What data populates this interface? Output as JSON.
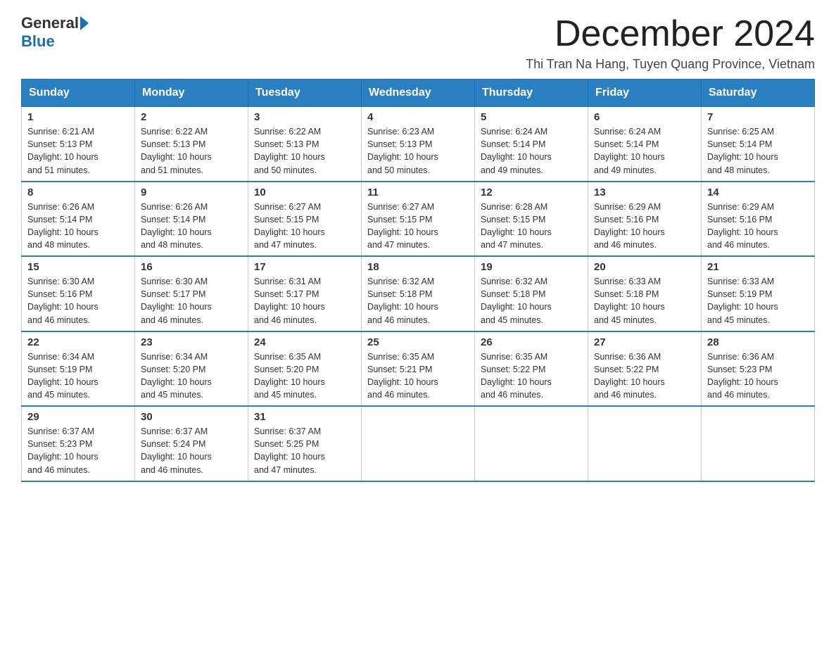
{
  "header": {
    "logo_general": "General",
    "logo_blue": "Blue",
    "month_title": "December 2024",
    "location": "Thi Tran Na Hang, Tuyen Quang Province, Vietnam"
  },
  "weekdays": [
    "Sunday",
    "Monday",
    "Tuesday",
    "Wednesday",
    "Thursday",
    "Friday",
    "Saturday"
  ],
  "weeks": [
    [
      {
        "day": "1",
        "sunrise": "6:21 AM",
        "sunset": "5:13 PM",
        "daylight": "10 hours and 51 minutes."
      },
      {
        "day": "2",
        "sunrise": "6:22 AM",
        "sunset": "5:13 PM",
        "daylight": "10 hours and 51 minutes."
      },
      {
        "day": "3",
        "sunrise": "6:22 AM",
        "sunset": "5:13 PM",
        "daylight": "10 hours and 50 minutes."
      },
      {
        "day": "4",
        "sunrise": "6:23 AM",
        "sunset": "5:13 PM",
        "daylight": "10 hours and 50 minutes."
      },
      {
        "day": "5",
        "sunrise": "6:24 AM",
        "sunset": "5:14 PM",
        "daylight": "10 hours and 49 minutes."
      },
      {
        "day": "6",
        "sunrise": "6:24 AM",
        "sunset": "5:14 PM",
        "daylight": "10 hours and 49 minutes."
      },
      {
        "day": "7",
        "sunrise": "6:25 AM",
        "sunset": "5:14 PM",
        "daylight": "10 hours and 48 minutes."
      }
    ],
    [
      {
        "day": "8",
        "sunrise": "6:26 AM",
        "sunset": "5:14 PM",
        "daylight": "10 hours and 48 minutes."
      },
      {
        "day": "9",
        "sunrise": "6:26 AM",
        "sunset": "5:14 PM",
        "daylight": "10 hours and 48 minutes."
      },
      {
        "day": "10",
        "sunrise": "6:27 AM",
        "sunset": "5:15 PM",
        "daylight": "10 hours and 47 minutes."
      },
      {
        "day": "11",
        "sunrise": "6:27 AM",
        "sunset": "5:15 PM",
        "daylight": "10 hours and 47 minutes."
      },
      {
        "day": "12",
        "sunrise": "6:28 AM",
        "sunset": "5:15 PM",
        "daylight": "10 hours and 47 minutes."
      },
      {
        "day": "13",
        "sunrise": "6:29 AM",
        "sunset": "5:16 PM",
        "daylight": "10 hours and 46 minutes."
      },
      {
        "day": "14",
        "sunrise": "6:29 AM",
        "sunset": "5:16 PM",
        "daylight": "10 hours and 46 minutes."
      }
    ],
    [
      {
        "day": "15",
        "sunrise": "6:30 AM",
        "sunset": "5:16 PM",
        "daylight": "10 hours and 46 minutes."
      },
      {
        "day": "16",
        "sunrise": "6:30 AM",
        "sunset": "5:17 PM",
        "daylight": "10 hours and 46 minutes."
      },
      {
        "day": "17",
        "sunrise": "6:31 AM",
        "sunset": "5:17 PM",
        "daylight": "10 hours and 46 minutes."
      },
      {
        "day": "18",
        "sunrise": "6:32 AM",
        "sunset": "5:18 PM",
        "daylight": "10 hours and 46 minutes."
      },
      {
        "day": "19",
        "sunrise": "6:32 AM",
        "sunset": "5:18 PM",
        "daylight": "10 hours and 45 minutes."
      },
      {
        "day": "20",
        "sunrise": "6:33 AM",
        "sunset": "5:18 PM",
        "daylight": "10 hours and 45 minutes."
      },
      {
        "day": "21",
        "sunrise": "6:33 AM",
        "sunset": "5:19 PM",
        "daylight": "10 hours and 45 minutes."
      }
    ],
    [
      {
        "day": "22",
        "sunrise": "6:34 AM",
        "sunset": "5:19 PM",
        "daylight": "10 hours and 45 minutes."
      },
      {
        "day": "23",
        "sunrise": "6:34 AM",
        "sunset": "5:20 PM",
        "daylight": "10 hours and 45 minutes."
      },
      {
        "day": "24",
        "sunrise": "6:35 AM",
        "sunset": "5:20 PM",
        "daylight": "10 hours and 45 minutes."
      },
      {
        "day": "25",
        "sunrise": "6:35 AM",
        "sunset": "5:21 PM",
        "daylight": "10 hours and 46 minutes."
      },
      {
        "day": "26",
        "sunrise": "6:35 AM",
        "sunset": "5:22 PM",
        "daylight": "10 hours and 46 minutes."
      },
      {
        "day": "27",
        "sunrise": "6:36 AM",
        "sunset": "5:22 PM",
        "daylight": "10 hours and 46 minutes."
      },
      {
        "day": "28",
        "sunrise": "6:36 AM",
        "sunset": "5:23 PM",
        "daylight": "10 hours and 46 minutes."
      }
    ],
    [
      {
        "day": "29",
        "sunrise": "6:37 AM",
        "sunset": "5:23 PM",
        "daylight": "10 hours and 46 minutes."
      },
      {
        "day": "30",
        "sunrise": "6:37 AM",
        "sunset": "5:24 PM",
        "daylight": "10 hours and 46 minutes."
      },
      {
        "day": "31",
        "sunrise": "6:37 AM",
        "sunset": "5:25 PM",
        "daylight": "10 hours and 47 minutes."
      },
      null,
      null,
      null,
      null
    ]
  ],
  "labels": {
    "sunrise": "Sunrise:",
    "sunset": "Sunset:",
    "daylight": "Daylight:"
  }
}
